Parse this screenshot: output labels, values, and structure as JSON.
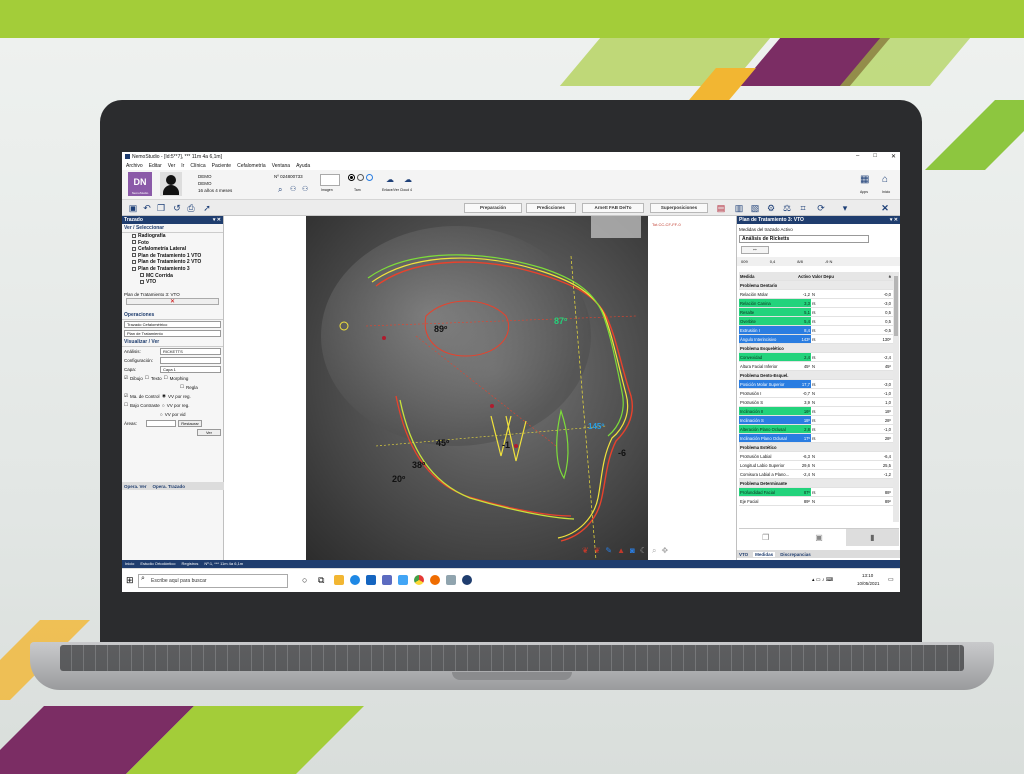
{
  "window": {
    "title": "NemoStudio - [Id:5**7], *** 11m 4a 6,1m]",
    "controls": [
      "–",
      "□",
      "✕"
    ]
  },
  "menu": [
    "Archivo",
    "Editar",
    "Ver",
    "Ir",
    "Clínica",
    "Paciente",
    "Cefalometría",
    "Ventana",
    "Ayuda"
  ],
  "ribbon": {
    "logo": "DN",
    "logo_sub": "NemoStudio",
    "patient_name": "DEMO",
    "patient_name2": "DEMO",
    "patient_age": "16 años 4 meses",
    "record_id": "Nº 024800733",
    "small_label1": "Imagen",
    "small_label2": "Tam",
    "cloud_label": "Enlace/Ver Cloud 4",
    "right_label1": "Apps",
    "right_label2": "Inicio"
  },
  "toolbar": {
    "btn_preparacion": "Preparación",
    "btn_predicciones": "Predicciones",
    "btn_arnett": "Arnett FAB De/To",
    "btn_superposiciones": "Superposiciones"
  },
  "left_panel": {
    "header": "Trazado",
    "section_ver": "Ver / Seleccionar",
    "tree": [
      "Radiografía",
      "Foto",
      "Cefalometría Lateral",
      "Plan de Tratamiento 1 VTO",
      "Plan de Tratamiento 2 VTO",
      "Plan de Tratamiento 3",
      "MC Corrida",
      "VTO"
    ],
    "plan_label": "Plan de Tratamiento 3: VTO",
    "section_operaciones": "Operaciones",
    "select1": "Trazado Cefalométrico",
    "select2": "Plan de Tratamiento",
    "section_visualizar": "Visualizar / Ver",
    "analysis_label": "Análisis:",
    "analysis_value": "RICKETTS",
    "config_label": "Configuración:",
    "capa_label": "Capa:",
    "capa_value": "Capa 1",
    "check_dibujo": "Dibujo",
    "check_texto": "Texto",
    "check_morphing": "Morphing",
    "check_regla": "Regla",
    "check_mallado": "Ma. de Control",
    "check_bajo": "Bajo Contraste",
    "radio1": "VV por reg.",
    "radio2": "VV por reg.",
    "radio3": "VV por vid",
    "areas_label": "Áreas:",
    "btn_restaurar": "Restaurar",
    "btn_ver": "Ver",
    "tab1": "Opera. Ver",
    "tab2": "Opera. Trazado"
  },
  "center": {
    "angle_89": "89º",
    "angle_87": "87º",
    "angle_45": "45º",
    "angle_38": "38º",
    "angle_20": "20º",
    "angle_145": "145º",
    "value_neg1": "-1",
    "value_neg6": "-6",
    "overlay_note": "Tot.CC-CF-FF-0"
  },
  "right_panel": {
    "header": "Plan de Tratamiento 3: VTO",
    "subtitle": "Medidas del trazado Activo",
    "analysis": "Análisis de Ricketts",
    "col_headers": [
      "Medida",
      "Activo",
      "Valor Depu",
      "",
      "±"
    ],
    "quick_values": [
      "009",
      "0,4",
      "8/8",
      "-9 N"
    ],
    "rows": [
      {
        "kind": "section",
        "label": "Problema Dentario"
      },
      {
        "kind": "row",
        "style": "plain",
        "label": "Relación Molar",
        "value": "-1,2",
        "unit": "N",
        "ref": "-0,0"
      },
      {
        "kind": "row",
        "style": "g",
        "label": "Relación Canina",
        "value": "3,3",
        "unit": "rs",
        "ref": "-3,0"
      },
      {
        "kind": "row",
        "style": "g",
        "label": "Resalte",
        "value": "5,1",
        "unit": "rs",
        "ref": "0,5"
      },
      {
        "kind": "row",
        "style": "g",
        "label": "Overbite",
        "value": "5,4",
        "unit": "rs",
        "ref": "0,5"
      },
      {
        "kind": "row",
        "style": "b",
        "label": "Extrusión I",
        "value": "8,4",
        "unit": "rs",
        "ref": "-0,5"
      },
      {
        "kind": "row",
        "style": "b",
        "label": "Ángulo Interincisivo",
        "value": "143º",
        "unit": "rs",
        "ref": "130º"
      },
      {
        "kind": "section",
        "label": "Problema Esquelético"
      },
      {
        "kind": "row",
        "style": "g",
        "label": "Convexidad",
        "value": "2,4",
        "unit": "rs",
        "ref": "-2,4"
      },
      {
        "kind": "row",
        "style": "plain",
        "label": "Altura Facial Inferior",
        "value": "45º",
        "unit": "N",
        "ref": "45º"
      },
      {
        "kind": "section",
        "label": "Problema Dento-Esquel."
      },
      {
        "kind": "row",
        "style": "b",
        "label": "Posición Molar Superior",
        "value": "17,7",
        "unit": "rs",
        "ref": "-3,0"
      },
      {
        "kind": "row",
        "style": "plain",
        "label": "Protrusión I",
        "value": "-0,7",
        "unit": "N",
        "ref": "-1,0"
      },
      {
        "kind": "row",
        "style": "plain",
        "label": "Protrusión S",
        "value": "3,9",
        "unit": "N",
        "ref": "1,0"
      },
      {
        "kind": "row",
        "style": "g",
        "label": "Inclinación II",
        "value": "16º",
        "unit": "rs",
        "ref": "18º"
      },
      {
        "kind": "row",
        "style": "b",
        "label": "Inclinación S",
        "value": "18º",
        "unit": "rs",
        "ref": "28º"
      },
      {
        "kind": "row",
        "style": "g",
        "label": "Alteración Plano Oclusal",
        "value": "2,8",
        "unit": "rs",
        "ref": "-1,0"
      },
      {
        "kind": "row",
        "style": "b",
        "label": "Inclinación Plano Oclusal",
        "value": "17º",
        "unit": "rs",
        "ref": "28º"
      },
      {
        "kind": "section",
        "label": "Problema Estético"
      },
      {
        "kind": "row",
        "style": "plain",
        "label": "Protrusión Labial",
        "value": "-6,3",
        "unit": "N",
        "ref": "-6,4"
      },
      {
        "kind": "row",
        "style": "plain",
        "label": "Longitud Labio Superior",
        "value": "29,6",
        "unit": "N",
        "ref": "25,5"
      },
      {
        "kind": "row",
        "style": "plain",
        "label": "Comisura Labial a Plano...",
        "value": "-2,4",
        "unit": "N",
        "ref": "-1,2"
      },
      {
        "kind": "section",
        "label": "Problema Determinante"
      },
      {
        "kind": "row",
        "style": "g",
        "label": "Profundidad Facial",
        "value": "87º",
        "unit": "rs",
        "ref": "88º"
      },
      {
        "kind": "row",
        "style": "plain",
        "label": "Eje Facial",
        "value": "89º",
        "unit": "N",
        "ref": "89º"
      }
    ],
    "tabs": [
      "VTO",
      "Medidas",
      "Discrepancias"
    ]
  },
  "statusbar": [
    "Inicio",
    "Estudio Ortodóntico",
    "Registros",
    "Nº:1, *** 11m 4a 6,1m"
  ],
  "taskbar": {
    "search_placeholder": "Escribe aquí para buscar",
    "time": "13:10",
    "date": "10/05/2021"
  }
}
